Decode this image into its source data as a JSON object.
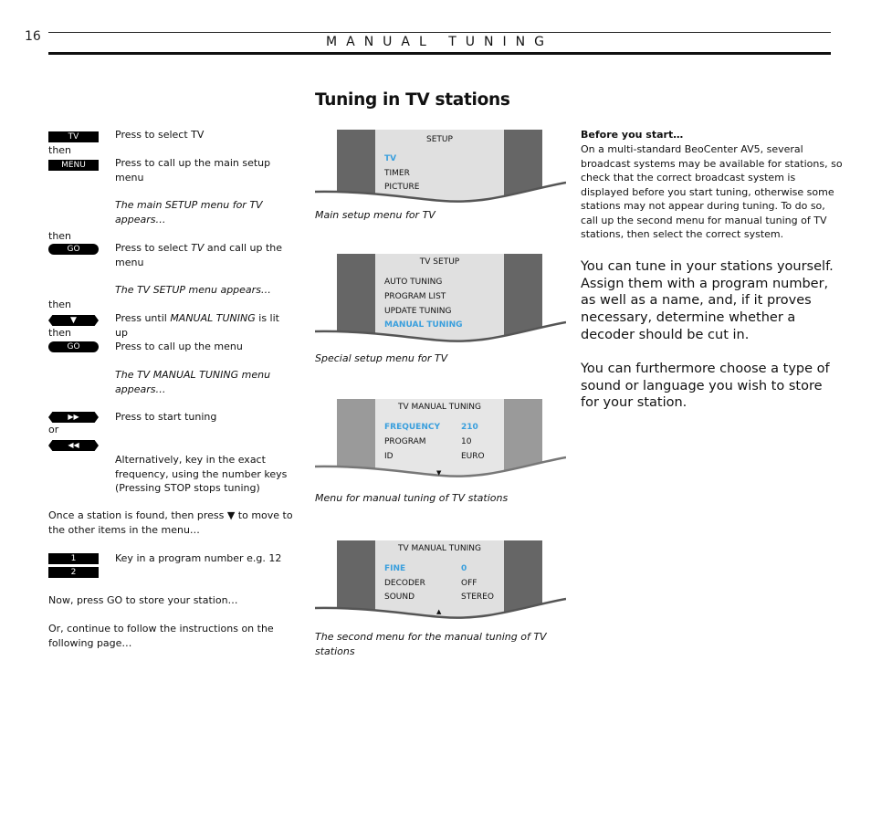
{
  "header": {
    "page_number": "16",
    "running_head": "MANUAL TUNING"
  },
  "title": "Tuning in TV stations",
  "steps": {
    "btn_tv": "TV",
    "then1": "then",
    "btn_menu": "MENU",
    "desc_tv": "Press to select TV",
    "desc_menu_1": "Press to call up the main setup",
    "desc_menu_2": "menu",
    "note_setup_1": "The main SETUP menu for TV",
    "note_setup_2": "appears…",
    "then2": "then",
    "btn_go1": "GO",
    "desc_go1_a": "Press to select ",
    "desc_go1_b": "TV",
    "desc_go1_c": " and call up the",
    "desc_go1_2": "menu",
    "note_tvsetup": "The TV SETUP menu appears…",
    "then3": "then",
    "btn_down": "▼",
    "desc_down_a": "Press until ",
    "desc_down_b": "MANUAL TUNING",
    "desc_down_c": " is lit",
    "desc_down_2": "up",
    "then4": "then",
    "btn_go2": "GO",
    "desc_go2": "Press to call up the menu",
    "note_manual_1": "The TV MANUAL TUNING menu",
    "note_manual_2": "appears…",
    "btn_ff": "▶▶",
    "desc_ff": "Press to start tuning",
    "or": "or",
    "btn_rew": "◀◀",
    "alt_1": "Alternatively, key in the exact",
    "alt_2": "frequency, using the number keys",
    "alt_3": "(Pressing STOP stops tuning)",
    "found_1": "Once a station is found, then press ▼ to move to",
    "found_2": "the other items in the menu…",
    "btn_1": "1",
    "btn_2": "2",
    "desc_keyin": "Key in a program number e.g. 12",
    "store": "Now, press GO to store your station…",
    "continue_1": "Or, continue to follow the instructions on the",
    "continue_2": "following page…"
  },
  "menus": [
    {
      "title": "SETUP",
      "items": [
        {
          "label": "TV",
          "highlighted": true
        },
        {
          "label": "TIMER",
          "highlighted": false
        },
        {
          "label": "PICTURE",
          "highlighted": false
        }
      ],
      "caption": "Main setup menu for TV"
    },
    {
      "title": "TV SETUP",
      "items": [
        {
          "label": "AUTO TUNING",
          "highlighted": false
        },
        {
          "label": "PROGRAM LIST",
          "highlighted": false
        },
        {
          "label": "UPDATE TUNING",
          "highlighted": false
        },
        {
          "label": "MANUAL TUNING",
          "highlighted": true
        }
      ],
      "caption": "Special setup menu for TV"
    },
    {
      "title": "TV MANUAL TUNING",
      "items": [
        {
          "label": "FREQUENCY",
          "value": "210",
          "highlighted": true
        },
        {
          "label": "PROGRAM",
          "value": "10",
          "highlighted": false
        },
        {
          "label": "ID",
          "value": "EURO",
          "highlighted": false
        }
      ],
      "indicator": "▼",
      "caption": "Menu for manual tuning of TV stations"
    },
    {
      "title": "TV MANUAL TUNING",
      "items": [
        {
          "label": "FINE",
          "value": "0",
          "highlighted": true
        },
        {
          "label": "DECODER",
          "value": "OFF",
          "highlighted": false
        },
        {
          "label": "SOUND",
          "value": "STEREO",
          "highlighted": false
        }
      ],
      "indicator": "▲",
      "caption_1": "The second menu for the manual tuning of TV",
      "caption_2": "stations"
    }
  ],
  "right": {
    "before_title": "Before you start…",
    "before_lines": [
      "On a multi-standard BeoCenter AV5, several",
      "broadcast systems may be available for stations, so",
      "check that the correct broadcast system is",
      "displayed before you start tuning, otherwise some",
      "stations may not appear during tuning. To do so,",
      "call up the second menu for manual tuning of TV",
      "stations, then select the correct system."
    ],
    "para1_lines": [
      "You can tune in your stations yourself.",
      "Assign them with a program number,",
      "as well as a name, and, if it proves",
      "necessary, determine whether a",
      "decoder should be cut in."
    ],
    "para2_lines": [
      "You can furthermore choose a type of",
      "sound or language you wish to store",
      "for your station."
    ]
  },
  "colors": {
    "highlight": "#3a9fdd",
    "menu_bg": "#e0e0e0",
    "menu_side": "#666666",
    "menu_side_light": "#9a9a9a"
  }
}
